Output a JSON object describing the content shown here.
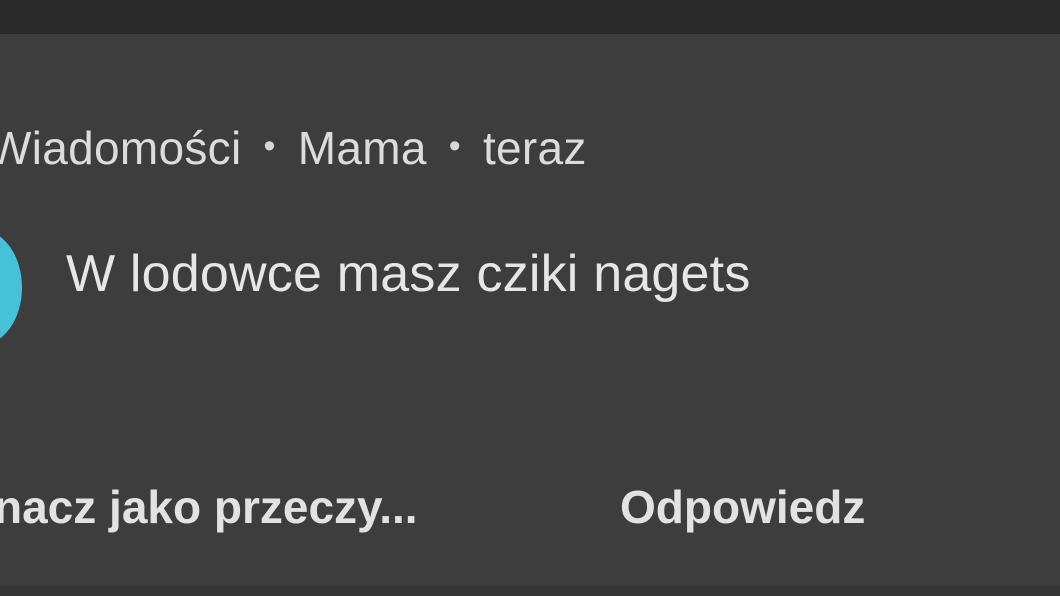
{
  "notification": {
    "app_name": "Wiadomości",
    "separator": "•",
    "sender": "Mama",
    "time": "teraz",
    "message": "W lodowce masz cziki nagets",
    "avatar_color": "#47c1d8",
    "actions": {
      "mark_read_label": "nacz jako przeczy...",
      "reply_label": "Odpowiedz"
    }
  }
}
